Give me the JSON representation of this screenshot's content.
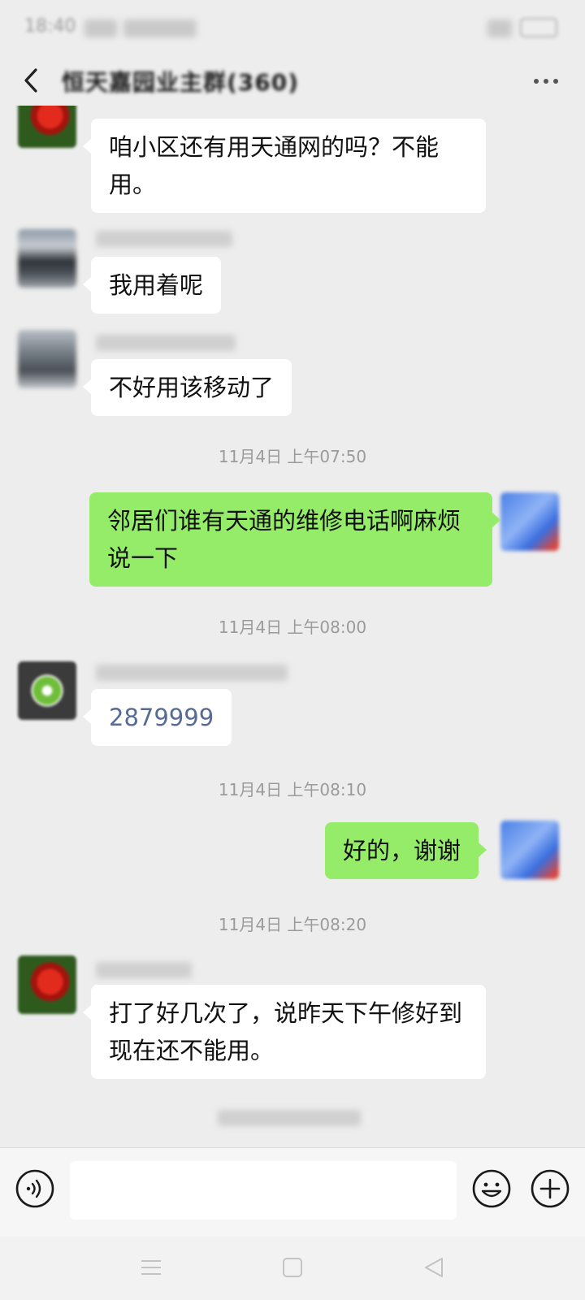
{
  "status_bar": {
    "time": "18:40"
  },
  "header": {
    "title": "恒天嘉园业主群(360)"
  },
  "messages": [
    {
      "text": "咱小区还有用天通网的吗？不能用。"
    },
    {
      "text": "我用着呢"
    },
    {
      "text": "不好用该移动了"
    },
    {
      "text": "邻居们谁有天通的维修电话啊麻烦说一下"
    },
    {
      "text": "2879999"
    },
    {
      "text": "好的，谢谢"
    },
    {
      "text": "打了好几次了，说昨天下午修好到现在还不能用。"
    }
  ],
  "timestamps": [
    "11月4日 上午07:50",
    "11月4日 上午08:00",
    "11月4日 上午08:10",
    "11月4日 上午08:20"
  ],
  "icons": {
    "back": "back-arrow-icon",
    "more": "more-dots-icon",
    "voice": "voice-icon",
    "emoji": "emoji-icon",
    "plus": "plus-icon",
    "nav_menu": "nav-menu-icon",
    "nav_home": "nav-home-icon",
    "nav_back": "nav-back-icon"
  },
  "colors": {
    "background": "#ededed",
    "incoming_bubble": "#ffffff",
    "outgoing_bubble": "#95ec69",
    "link_number": "#576b95",
    "timestamp": "#9b9b9b"
  }
}
